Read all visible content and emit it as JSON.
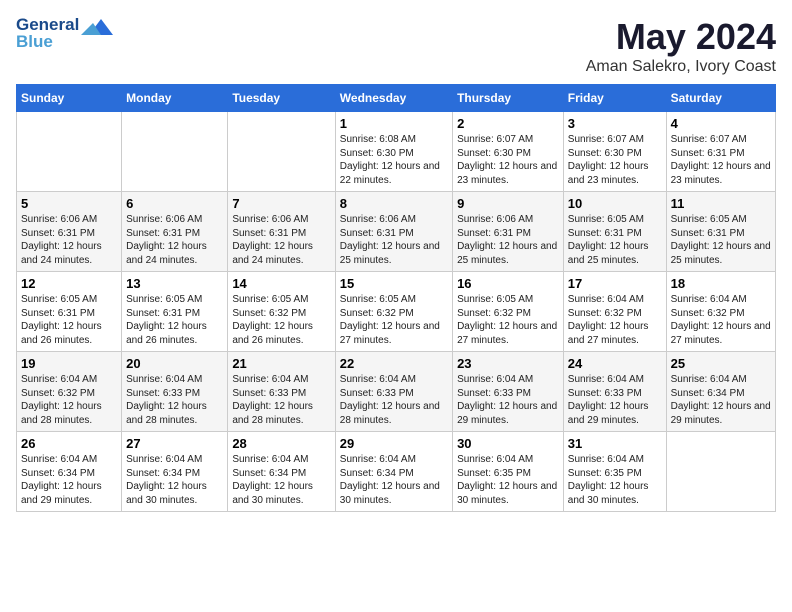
{
  "logo": {
    "line1": "General",
    "line2": "Blue"
  },
  "title": "May 2024",
  "subtitle": "Aman Salekro, Ivory Coast",
  "headers": [
    "Sunday",
    "Monday",
    "Tuesday",
    "Wednesday",
    "Thursday",
    "Friday",
    "Saturday"
  ],
  "weeks": [
    [
      {
        "day": "",
        "sunrise": "",
        "sunset": "",
        "daylight": ""
      },
      {
        "day": "",
        "sunrise": "",
        "sunset": "",
        "daylight": ""
      },
      {
        "day": "",
        "sunrise": "",
        "sunset": "",
        "daylight": ""
      },
      {
        "day": "1",
        "sunrise": "Sunrise: 6:08 AM",
        "sunset": "Sunset: 6:30 PM",
        "daylight": "Daylight: 12 hours and 22 minutes."
      },
      {
        "day": "2",
        "sunrise": "Sunrise: 6:07 AM",
        "sunset": "Sunset: 6:30 PM",
        "daylight": "Daylight: 12 hours and 23 minutes."
      },
      {
        "day": "3",
        "sunrise": "Sunrise: 6:07 AM",
        "sunset": "Sunset: 6:30 PM",
        "daylight": "Daylight: 12 hours and 23 minutes."
      },
      {
        "day": "4",
        "sunrise": "Sunrise: 6:07 AM",
        "sunset": "Sunset: 6:31 PM",
        "daylight": "Daylight: 12 hours and 23 minutes."
      }
    ],
    [
      {
        "day": "5",
        "sunrise": "Sunrise: 6:06 AM",
        "sunset": "Sunset: 6:31 PM",
        "daylight": "Daylight: 12 hours and 24 minutes."
      },
      {
        "day": "6",
        "sunrise": "Sunrise: 6:06 AM",
        "sunset": "Sunset: 6:31 PM",
        "daylight": "Daylight: 12 hours and 24 minutes."
      },
      {
        "day": "7",
        "sunrise": "Sunrise: 6:06 AM",
        "sunset": "Sunset: 6:31 PM",
        "daylight": "Daylight: 12 hours and 24 minutes."
      },
      {
        "day": "8",
        "sunrise": "Sunrise: 6:06 AM",
        "sunset": "Sunset: 6:31 PM",
        "daylight": "Daylight: 12 hours and 25 minutes."
      },
      {
        "day": "9",
        "sunrise": "Sunrise: 6:06 AM",
        "sunset": "Sunset: 6:31 PM",
        "daylight": "Daylight: 12 hours and 25 minutes."
      },
      {
        "day": "10",
        "sunrise": "Sunrise: 6:05 AM",
        "sunset": "Sunset: 6:31 PM",
        "daylight": "Daylight: 12 hours and 25 minutes."
      },
      {
        "day": "11",
        "sunrise": "Sunrise: 6:05 AM",
        "sunset": "Sunset: 6:31 PM",
        "daylight": "Daylight: 12 hours and 25 minutes."
      }
    ],
    [
      {
        "day": "12",
        "sunrise": "Sunrise: 6:05 AM",
        "sunset": "Sunset: 6:31 PM",
        "daylight": "Daylight: 12 hours and 26 minutes."
      },
      {
        "day": "13",
        "sunrise": "Sunrise: 6:05 AM",
        "sunset": "Sunset: 6:31 PM",
        "daylight": "Daylight: 12 hours and 26 minutes."
      },
      {
        "day": "14",
        "sunrise": "Sunrise: 6:05 AM",
        "sunset": "Sunset: 6:32 PM",
        "daylight": "Daylight: 12 hours and 26 minutes."
      },
      {
        "day": "15",
        "sunrise": "Sunrise: 6:05 AM",
        "sunset": "Sunset: 6:32 PM",
        "daylight": "Daylight: 12 hours and 27 minutes."
      },
      {
        "day": "16",
        "sunrise": "Sunrise: 6:05 AM",
        "sunset": "Sunset: 6:32 PM",
        "daylight": "Daylight: 12 hours and 27 minutes."
      },
      {
        "day": "17",
        "sunrise": "Sunrise: 6:04 AM",
        "sunset": "Sunset: 6:32 PM",
        "daylight": "Daylight: 12 hours and 27 minutes."
      },
      {
        "day": "18",
        "sunrise": "Sunrise: 6:04 AM",
        "sunset": "Sunset: 6:32 PM",
        "daylight": "Daylight: 12 hours and 27 minutes."
      }
    ],
    [
      {
        "day": "19",
        "sunrise": "Sunrise: 6:04 AM",
        "sunset": "Sunset: 6:32 PM",
        "daylight": "Daylight: 12 hours and 28 minutes."
      },
      {
        "day": "20",
        "sunrise": "Sunrise: 6:04 AM",
        "sunset": "Sunset: 6:33 PM",
        "daylight": "Daylight: 12 hours and 28 minutes."
      },
      {
        "day": "21",
        "sunrise": "Sunrise: 6:04 AM",
        "sunset": "Sunset: 6:33 PM",
        "daylight": "Daylight: 12 hours and 28 minutes."
      },
      {
        "day": "22",
        "sunrise": "Sunrise: 6:04 AM",
        "sunset": "Sunset: 6:33 PM",
        "daylight": "Daylight: 12 hours and 28 minutes."
      },
      {
        "day": "23",
        "sunrise": "Sunrise: 6:04 AM",
        "sunset": "Sunset: 6:33 PM",
        "daylight": "Daylight: 12 hours and 29 minutes."
      },
      {
        "day": "24",
        "sunrise": "Sunrise: 6:04 AM",
        "sunset": "Sunset: 6:33 PM",
        "daylight": "Daylight: 12 hours and 29 minutes."
      },
      {
        "day": "25",
        "sunrise": "Sunrise: 6:04 AM",
        "sunset": "Sunset: 6:34 PM",
        "daylight": "Daylight: 12 hours and 29 minutes."
      }
    ],
    [
      {
        "day": "26",
        "sunrise": "Sunrise: 6:04 AM",
        "sunset": "Sunset: 6:34 PM",
        "daylight": "Daylight: 12 hours and 29 minutes."
      },
      {
        "day": "27",
        "sunrise": "Sunrise: 6:04 AM",
        "sunset": "Sunset: 6:34 PM",
        "daylight": "Daylight: 12 hours and 30 minutes."
      },
      {
        "day": "28",
        "sunrise": "Sunrise: 6:04 AM",
        "sunset": "Sunset: 6:34 PM",
        "daylight": "Daylight: 12 hours and 30 minutes."
      },
      {
        "day": "29",
        "sunrise": "Sunrise: 6:04 AM",
        "sunset": "Sunset: 6:34 PM",
        "daylight": "Daylight: 12 hours and 30 minutes."
      },
      {
        "day": "30",
        "sunrise": "Sunrise: 6:04 AM",
        "sunset": "Sunset: 6:35 PM",
        "daylight": "Daylight: 12 hours and 30 minutes."
      },
      {
        "day": "31",
        "sunrise": "Sunrise: 6:04 AM",
        "sunset": "Sunset: 6:35 PM",
        "daylight": "Daylight: 12 hours and 30 minutes."
      },
      {
        "day": "",
        "sunrise": "",
        "sunset": "",
        "daylight": ""
      }
    ]
  ]
}
